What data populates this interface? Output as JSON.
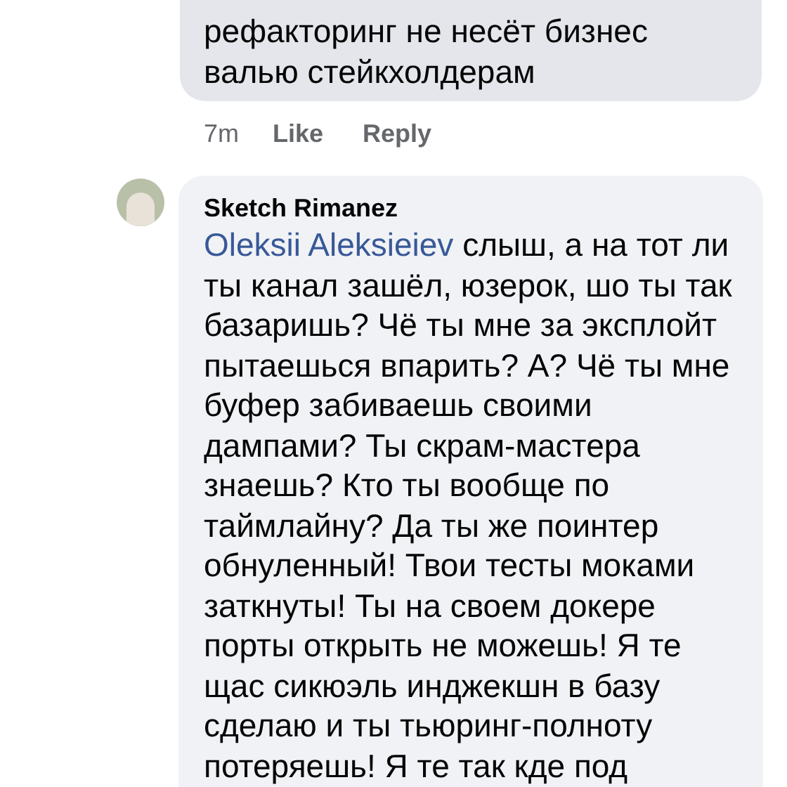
{
  "comments": [
    {
      "lines": [
        "рефакторинг не несёт бизнес",
        "валью стейкхолдерам"
      ],
      "time": "7m",
      "like": "Like",
      "reply": "Reply"
    },
    {
      "author": "Sketch Rimanez",
      "mention": "Oleksii Aleksieiev",
      "lines": [
        " слыш, а на тот ли",
        "ты канал зашёл, юзерок, шо ты так",
        "базаришь? Чё ты мне за эксплойт",
        "пытаешься впарить? А? Чё ты мне",
        "буфер забиваешь своими",
        "дампами? Ты скрам-мастера",
        "знаешь? Кто ты вообще по",
        "таймлайну? Да ты же поинтер",
        "обнуленный! Твои тесты моками",
        "заткнуты! Ты на своем докере",
        "порты открыть не можешь! Я те",
        "щас сикюэль инджекшн в базу",
        "сделаю и ты тьюринг-полноту",
        "потеряешь! Я те так кде под"
      ]
    }
  ]
}
